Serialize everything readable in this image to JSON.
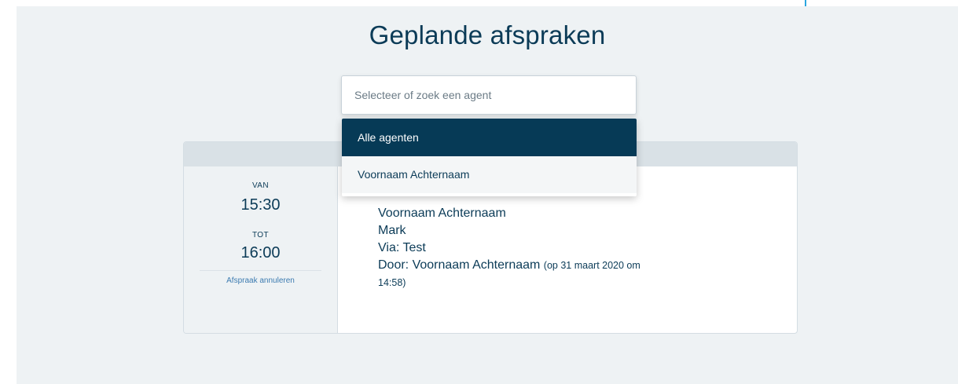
{
  "page": {
    "title": "Geplande afspraken"
  },
  "agent_select": {
    "placeholder": "Selecteer of zoek een agent",
    "options": [
      {
        "label": "Alle agenten",
        "selected": true
      },
      {
        "label": "Voornaam Achternaam",
        "selected": false
      }
    ]
  },
  "appointment": {
    "from_label": "VAN",
    "from_time": "15:30",
    "to_label": "TOT",
    "to_time": "16:00",
    "cancel_label": "Afspraak annuleren",
    "name": "Voornaam Achternaam",
    "contact": "Mark",
    "via": "Via: Test",
    "by": "Door: Voornaam Achternaam",
    "by_meta": "(op 31 maart 2020 om 14:58)"
  },
  "colors": {
    "primary": "#063a56",
    "text": "#0b3b57",
    "link": "#3c7bb0",
    "background": "#eef2f4",
    "accent_line": "#2aa6e0"
  }
}
